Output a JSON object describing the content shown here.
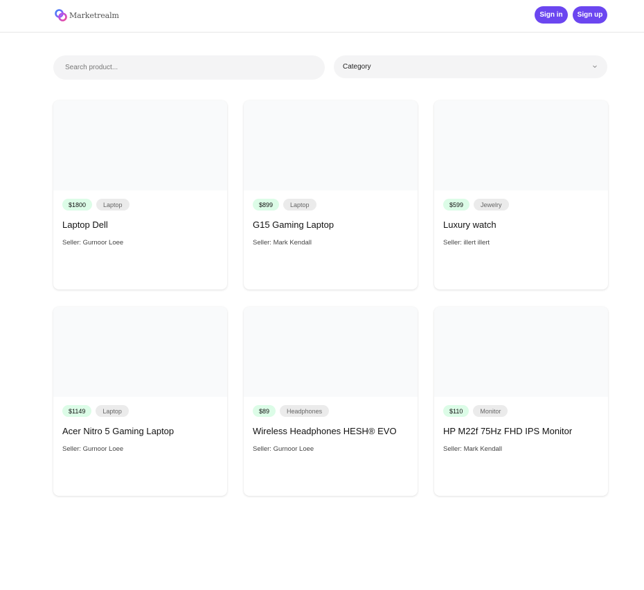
{
  "header": {
    "brand_name": "Marketrealm",
    "signin_label": "Sign in",
    "signup_label": "Sign up"
  },
  "filters": {
    "search_placeholder": "Search product...",
    "search_value": "",
    "category_label": "Category"
  },
  "colors": {
    "accent": "#6b46f0",
    "price_badge_bg": "#dcfce7",
    "category_badge_bg": "#ebebeb",
    "input_bg": "#f4f4f5"
  },
  "products": [
    {
      "price": "$1800",
      "category": "Laptop",
      "title": "Laptop Dell",
      "seller": "Seller: Gurnoor Loee"
    },
    {
      "price": "$899",
      "category": "Laptop",
      "title": "G15 Gaming Laptop",
      "seller": "Seller: Mark Kendall"
    },
    {
      "price": "$599",
      "category": "Jewelry",
      "title": "Luxury watch",
      "seller": "Seller: illert illert"
    },
    {
      "price": "$1149",
      "category": "Laptop",
      "title": "Acer Nitro 5 Gaming Laptop",
      "seller": "Seller: Gurnoor Loee"
    },
    {
      "price": "$89",
      "category": "Headphones",
      "title": "Wireless Headphones HESH® EVO",
      "seller": "Seller: Gurnoor Loee"
    },
    {
      "price": "$110",
      "category": "Monitor",
      "title": "HP M22f 75Hz FHD IPS Monitor",
      "seller": "Seller: Mark Kendall"
    }
  ]
}
